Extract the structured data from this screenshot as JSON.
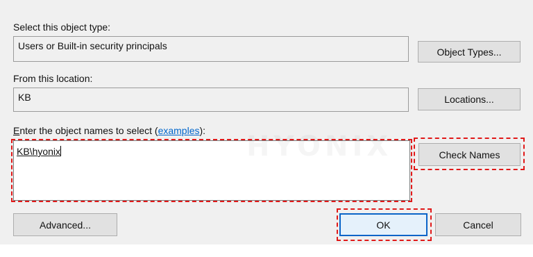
{
  "dialog": {
    "object_type_label": "Select this object type:",
    "object_type_value": "Users or Built-in security principals",
    "object_types_button": "Object Types...",
    "location_label": "From this location:",
    "location_value": "KB",
    "locations_button": "Locations...",
    "names_label_prefix": "nter the object names to select (",
    "names_label_first_char": "E",
    "names_label_link": "examples",
    "names_label_suffix": "):",
    "names_value": "KB\\hyonix",
    "check_names_button": "Check Names",
    "advanced_button": "Advanced...",
    "ok_button": "OK",
    "cancel_button": "Cancel"
  },
  "watermark": "HYONIX",
  "colors": {
    "highlight_dash": "#e01818",
    "link": "#0066cc",
    "dialog_bg": "#f0f0f0"
  }
}
